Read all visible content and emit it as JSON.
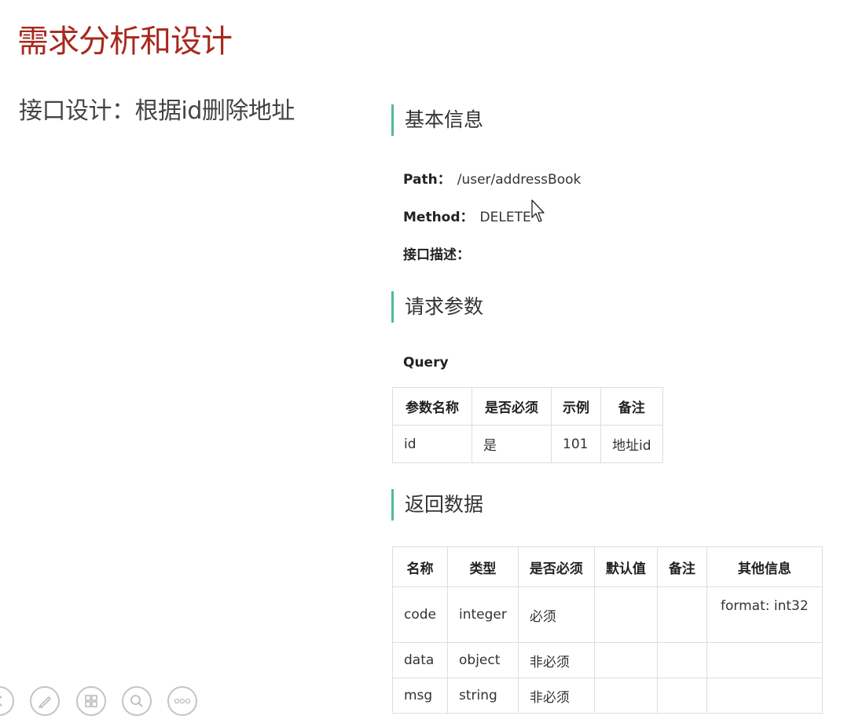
{
  "slide": {
    "title": "需求分析和设计",
    "subtitle": "接口设计：根据id删除地址"
  },
  "basic_info": {
    "heading": "基本信息",
    "path_label": "Path：",
    "path_value": "/user/addressBook",
    "method_label": "Method：",
    "method_value": "DELETE",
    "desc_label": "接口描述："
  },
  "request_params": {
    "heading": "请求参数",
    "query_label": "Query",
    "columns": [
      "参数名称",
      "是否必须",
      "示例",
      "备注"
    ],
    "rows": [
      [
        "id",
        "是",
        "101",
        "地址id"
      ]
    ]
  },
  "response": {
    "heading": "返回数据",
    "columns": [
      "名称",
      "类型",
      "是否必须",
      "默认值",
      "备注",
      "其他信息"
    ],
    "rows": [
      [
        "code",
        "integer",
        "必须",
        "",
        "",
        "format: int32"
      ],
      [
        "data",
        "object",
        "非必须",
        "",
        "",
        ""
      ],
      [
        "msg",
        "string",
        "非必须",
        "",
        "",
        ""
      ]
    ]
  },
  "toolbar": {
    "icons": [
      "arrow-icon",
      "pen-icon",
      "grid-icon",
      "zoom-icon",
      "more-icon"
    ],
    "color": "#c4c4c4"
  },
  "colors": {
    "title": "#a8281d",
    "accent_bar": "#4ebd8d"
  }
}
